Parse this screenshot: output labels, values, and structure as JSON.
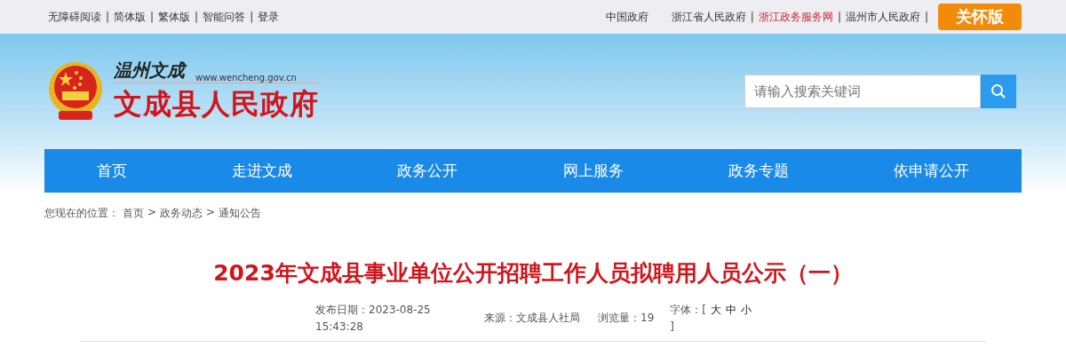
{
  "top_bar": {
    "left_links": [
      {
        "kind": "link",
        "text": "无障碍阅读"
      },
      {
        "kind": "sep",
        "text": "|"
      },
      {
        "kind": "link",
        "text": "简体版"
      },
      {
        "kind": "sep",
        "text": "|"
      },
      {
        "kind": "link",
        "text": "繁体版"
      },
      {
        "kind": "sep",
        "text": "|"
      },
      {
        "kind": "link",
        "text": "智能问答"
      },
      {
        "kind": "sep",
        "text": "|"
      },
      {
        "kind": "link",
        "text": "登录"
      }
    ],
    "right_links": [
      {
        "kind": "link",
        "text": "中国政府",
        "highlighted": false
      },
      {
        "kind": "link",
        "text": "浙江省人民政府",
        "highlighted": false
      },
      {
        "kind": "sep",
        "text": "|"
      },
      {
        "kind": "link",
        "text": "浙江政务服务网",
        "highlighted": true
      },
      {
        "kind": "sep",
        "text": "|"
      },
      {
        "kind": "link",
        "text": "温州市人民政府",
        "highlighted": false
      },
      {
        "kind": "sep",
        "text": "|"
      }
    ],
    "care_button": "关怀版"
  },
  "header": {
    "calligraphy": "温州文成",
    "url": "www.wencheng.gov.cn",
    "site_name": "文成县人民政府",
    "search": {
      "placeholder": "请输入搜索关键词"
    }
  },
  "nav": [
    "首页",
    "走进文成",
    "政务公开",
    "网上服务",
    "政务专题",
    "依申请公开"
  ],
  "breadcrumb": {
    "prefix": "您现在的位置：",
    "items": [
      "首页",
      "政务动态",
      "通知公告"
    ],
    "separator": ">"
  },
  "article": {
    "title": "2023年文成县事业单位公开招聘工作人员拟聘用人员公示（一）",
    "date_label": "发布日期：2023-08-25 15:43:28",
    "source": "来源：文成县人社局",
    "views": "浏览量：19",
    "font_label": "字体：[",
    "font_sizes": [
      "大",
      "中",
      "小"
    ],
    "font_close": "]"
  }
}
